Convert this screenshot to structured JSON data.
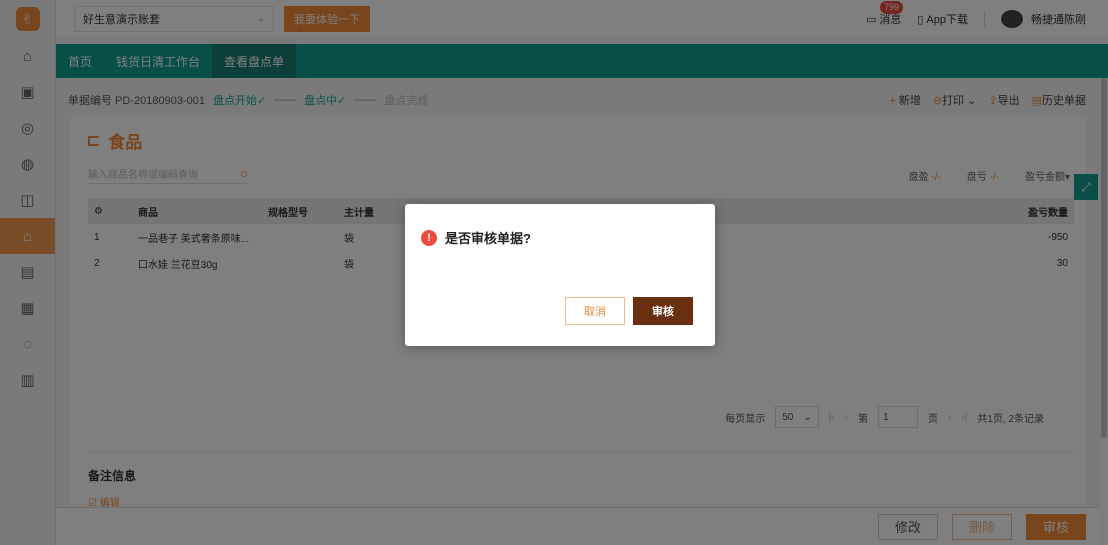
{
  "topbar": {
    "account": "好生意演示账套",
    "try_button": "我要体验一下",
    "messages_label": "消息",
    "messages_badge": "799",
    "app_download": "App下载",
    "username": "畅捷通陈刚"
  },
  "nav": {
    "tabs": [
      {
        "label": "首页"
      },
      {
        "label": "钱货日清工作台"
      },
      {
        "label": "查看盘点单"
      }
    ]
  },
  "doc": {
    "number_label": "单据编号 PD-20180903-001",
    "steps": [
      {
        "label": "盘点开始✓"
      },
      {
        "label": "盘点中✓"
      },
      {
        "label": "盘点完成"
      }
    ],
    "actions": {
      "new": "新增",
      "print": "打印",
      "export": "导出",
      "history": "历史单据"
    }
  },
  "card": {
    "title": "食品",
    "search_placeholder": "输入商品名称或编码查询",
    "stats": {
      "gain_label": "盘盈",
      "gain_value": "-/-",
      "loss_label": "盘亏",
      "loss_value": "-/-",
      "amount_label": "盈亏金额▾"
    },
    "table": {
      "headers": [
        "",
        "商品",
        "规格型号",
        "主计量",
        "盈亏数量"
      ],
      "rows": [
        {
          "index": "1",
          "product": "一品巷子 美式奢条原味...",
          "spec": "",
          "unit": "袋",
          "qty": "-950"
        },
        {
          "index": "2",
          "product": "口水娃 兰花豆30g",
          "spec": "",
          "unit": "袋",
          "qty": "30"
        }
      ]
    },
    "pager": {
      "per_page_label": "每页显示",
      "per_page_value": "50",
      "page_prefix": "第",
      "page_value": "1",
      "page_suffix": "页",
      "total": "共1页, 2条记录"
    },
    "note_title": "备注信息",
    "edit_label": "编辑"
  },
  "footer": {
    "modify": "修改",
    "delete": "删除",
    "audit": "审核"
  },
  "modal": {
    "message": "是否审核单据?",
    "cancel": "取消",
    "confirm": "审核"
  },
  "colors": {
    "brand_orange": "#f08a38",
    "teal_nav": "#0e9f8e",
    "modal_confirm": "#6a2f10",
    "warn_red": "#e94b3c"
  }
}
